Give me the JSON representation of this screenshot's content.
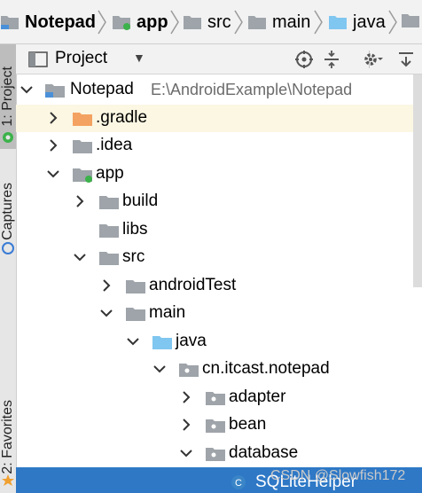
{
  "breadcrumb": {
    "items": [
      {
        "label": "Notepad",
        "icon": "module-folder-icon",
        "bold": true
      },
      {
        "label": "app",
        "icon": "module-folder-icon",
        "bold": true
      },
      {
        "label": "src",
        "icon": "folder-icon",
        "bold": false
      },
      {
        "label": "main",
        "icon": "folder-icon",
        "bold": false
      },
      {
        "label": "java",
        "icon": "source-folder-icon",
        "bold": false
      }
    ]
  },
  "toolwindow_strip": {
    "tabs": [
      {
        "label": "1: Project",
        "active": true
      },
      {
        "label": "Captures",
        "active": false
      },
      {
        "label": "2: Favorites",
        "active": false
      }
    ]
  },
  "project_panel": {
    "title": "Project",
    "view_dropdown_icon": "caret-down-icon",
    "actions": [
      "locate-icon",
      "collapse-all-icon",
      "settings-gear-icon",
      "hide-panel-icon"
    ]
  },
  "tree": {
    "rows": [
      {
        "label": "Notepad",
        "path": "E:\\AndroidExample\\Notepad",
        "expanded": true,
        "icon": "module-folder-icon",
        "selected": false
      },
      {
        "label": ".gradle",
        "expanded": false,
        "icon": "orange-folder-icon",
        "selected": true
      },
      {
        "label": ".idea",
        "expanded": false,
        "icon": "folder-icon",
        "selected": false
      },
      {
        "label": "app",
        "expanded": true,
        "icon": "module-folder-icon",
        "selected": false
      },
      {
        "label": "build",
        "expanded": false,
        "icon": "folder-icon",
        "selected": false
      },
      {
        "label": "libs",
        "expanded": null,
        "icon": "folder-icon",
        "selected": false
      },
      {
        "label": "src",
        "expanded": true,
        "icon": "folder-icon",
        "selected": false
      },
      {
        "label": "androidTest",
        "expanded": false,
        "icon": "folder-icon",
        "selected": false
      },
      {
        "label": "main",
        "expanded": true,
        "icon": "folder-icon",
        "selected": false
      },
      {
        "label": "java",
        "expanded": true,
        "icon": "source-folder-icon",
        "selected": false
      },
      {
        "label": "cn.itcast.notepad",
        "expanded": true,
        "icon": "package-icon",
        "selected": false
      },
      {
        "label": "adapter",
        "expanded": false,
        "icon": "package-icon",
        "selected": false
      },
      {
        "label": "bean",
        "expanded": false,
        "icon": "package-icon",
        "selected": false
      },
      {
        "label": "database",
        "expanded": true,
        "icon": "package-icon",
        "selected": false
      },
      {
        "label": "SQLiteHelper",
        "expanded": null,
        "icon": "class-icon",
        "selected": false
      }
    ]
  },
  "watermark": "CSDN @Slowfish172",
  "colors": {
    "selection_highlight": "#2e78c6",
    "row_highlight": "#fbf7e3",
    "folder_gray": "#9ea4a9",
    "folder_orange": "#f4a261",
    "folder_blue": "#7fc6f0",
    "module_dot": "#3cb24b"
  }
}
